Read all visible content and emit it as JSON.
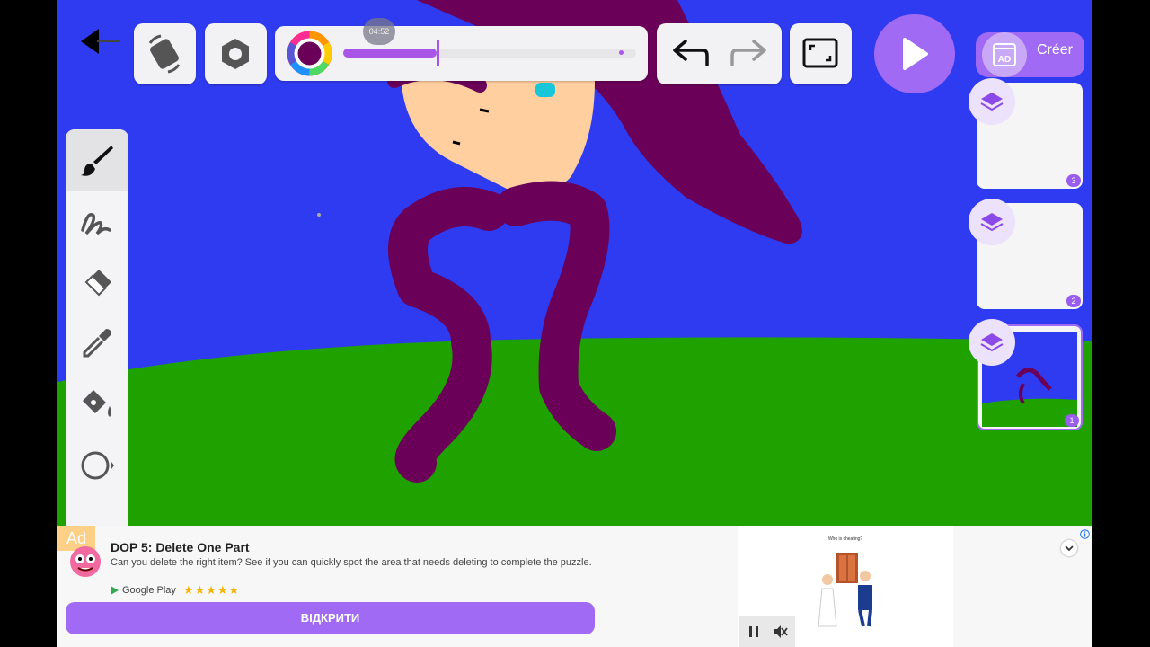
{
  "toolbar": {
    "timer_badge": "04:52",
    "size_slider_value": 0.33,
    "create_label": "Créer",
    "ad_icon_label": "AD"
  },
  "tools": [
    {
      "name": "brush"
    },
    {
      "name": "pencil"
    },
    {
      "name": "eraser"
    },
    {
      "name": "eyedropper"
    },
    {
      "name": "fill-bucket"
    },
    {
      "name": "shape"
    }
  ],
  "frames": [
    {
      "number": "3"
    },
    {
      "number": "2"
    },
    {
      "number": "1"
    }
  ],
  "colors": {
    "accent": "#a06af4",
    "sky": "#2f3bf0",
    "grass": "#1fa100",
    "hair": "#6a0057",
    "skin": "#ffcfa0"
  },
  "ad": {
    "badge": "Ad",
    "title": "DOP 5: Delete One Part",
    "description": "Can you delete the right item? See if you can quickly spot the area that needs deleting to complete the puzzle.",
    "store": "Google Play",
    "rating_stars": "★★★★★",
    "cta": "ВІДКРИТИ",
    "image_caption": "Who is cheating?"
  }
}
